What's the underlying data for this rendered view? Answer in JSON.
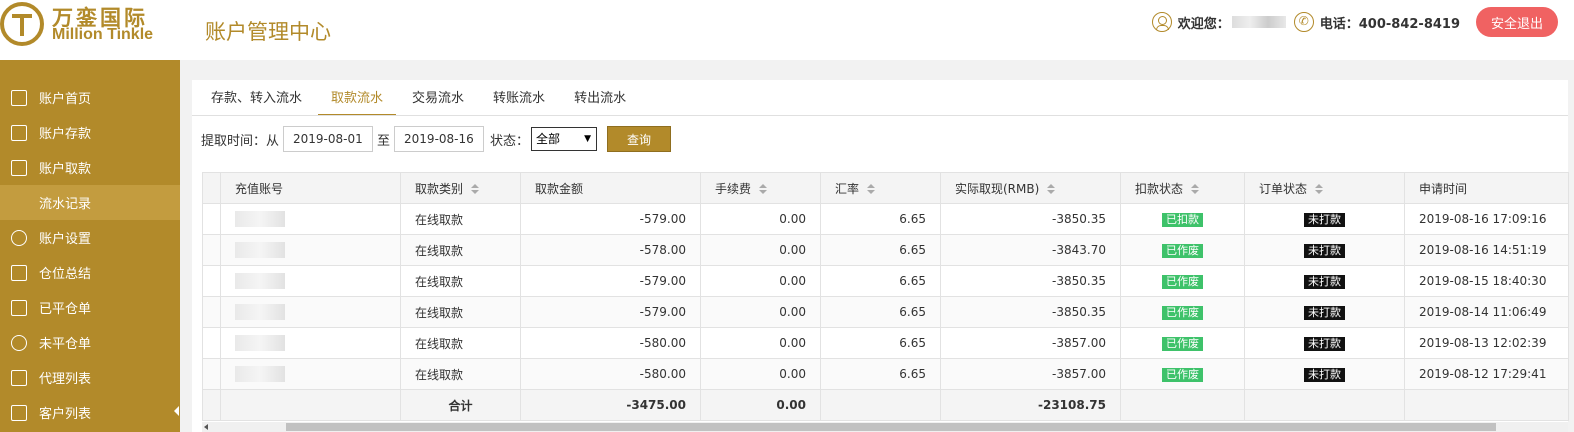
{
  "header": {
    "logo_cn": "万銮国际",
    "logo_en": "Million Tinkle",
    "page_title": "账户管理中心",
    "welcome_label": "欢迎您：",
    "phone_label": "电话：400-842-8419",
    "logout_label": "安全退出",
    "accent_color": "#b28a2a",
    "logout_color": "#f06262"
  },
  "sidebar": {
    "items": [
      {
        "label": "账户首页",
        "icon": "home-icon"
      },
      {
        "label": "账户存款",
        "icon": "deposit-icon"
      },
      {
        "label": "账户取款",
        "icon": "withdraw-icon"
      },
      {
        "label": "流水记录",
        "icon": "",
        "active": true
      },
      {
        "label": "账户设置",
        "icon": "gear-icon"
      },
      {
        "label": "仓位总结",
        "icon": "position-icon"
      },
      {
        "label": "已平仓单",
        "icon": "bank-icon"
      },
      {
        "label": "未平仓单",
        "icon": "coin-icon"
      },
      {
        "label": "代理列表",
        "icon": "list-icon"
      },
      {
        "label": "客户列表",
        "icon": "customer-icon"
      }
    ]
  },
  "tabs": [
    {
      "label": "存款、转入流水",
      "active": false
    },
    {
      "label": "取款流水",
      "active": true
    },
    {
      "label": "交易流水",
      "active": false
    },
    {
      "label": "转账流水",
      "active": false
    },
    {
      "label": "转出流水",
      "active": false
    }
  ],
  "filter": {
    "time_label": "提取时间：从",
    "start_date": "2019-08-01",
    "to_label": "至",
    "end_date": "2019-08-16",
    "status_label": "状态：",
    "status_value": "全部",
    "query_label": "查询"
  },
  "table": {
    "headers": [
      "充值账号",
      "取款类别",
      "取款金额",
      "手续费",
      "汇率",
      "实际取现(RMB)",
      "扣款状态",
      "订单状态",
      "申请时间"
    ],
    "rows": [
      {
        "type": "在线取款",
        "amount": "-579.00",
        "fee": "0.00",
        "rate": "6.65",
        "actual": "-3850.35",
        "deduct": "已扣款",
        "order": "未打款",
        "time": "2019-08-16 17:09:16"
      },
      {
        "type": "在线取款",
        "amount": "-578.00",
        "fee": "0.00",
        "rate": "6.65",
        "actual": "-3843.70",
        "deduct": "已作废",
        "order": "未打款",
        "time": "2019-08-16 14:51:19"
      },
      {
        "type": "在线取款",
        "amount": "-579.00",
        "fee": "0.00",
        "rate": "6.65",
        "actual": "-3850.35",
        "deduct": "已作废",
        "order": "未打款",
        "time": "2019-08-15 18:40:30"
      },
      {
        "type": "在线取款",
        "amount": "-579.00",
        "fee": "0.00",
        "rate": "6.65",
        "actual": "-3850.35",
        "deduct": "已作废",
        "order": "未打款",
        "time": "2019-08-14 11:06:49"
      },
      {
        "type": "在线取款",
        "amount": "-580.00",
        "fee": "0.00",
        "rate": "6.65",
        "actual": "-3857.00",
        "deduct": "已作废",
        "order": "未打款",
        "time": "2019-08-13 12:02:39"
      },
      {
        "type": "在线取款",
        "amount": "-580.00",
        "fee": "0.00",
        "rate": "6.65",
        "actual": "-3857.00",
        "deduct": "已作废",
        "order": "未打款",
        "time": "2019-08-12 17:29:41"
      }
    ],
    "total": {
      "label": "合计",
      "amount": "-3475.00",
      "fee": "0.00",
      "actual": "-23108.75"
    },
    "badge_green": "#3ec26a",
    "badge_black": "#111111"
  }
}
